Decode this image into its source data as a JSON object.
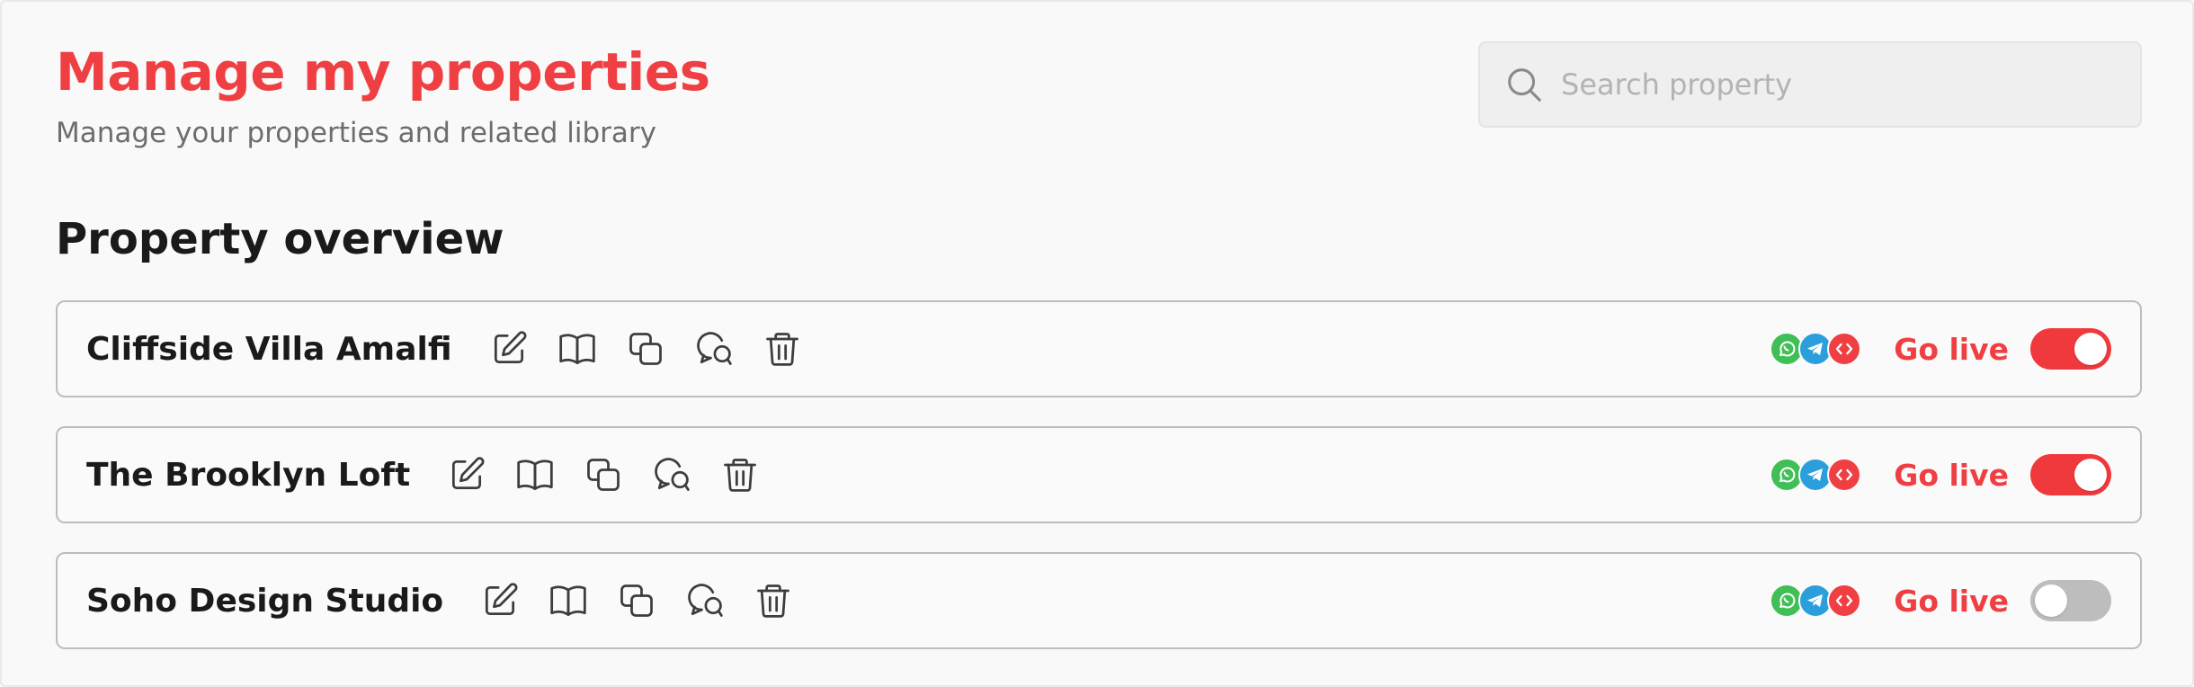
{
  "header": {
    "title": "Manage my properties",
    "subtitle": "Manage your properties and related library"
  },
  "search": {
    "placeholder": "Search property",
    "value": "",
    "icon": "search-icon"
  },
  "overview": {
    "title": "Property overview",
    "go_live_label": "Go live",
    "channel_icons": [
      "whatsapp-icon",
      "telegram-icon",
      "embed-code-icon"
    ],
    "action_icons": [
      "edit-icon",
      "library-book-icon",
      "duplicate-icon",
      "chat-icon",
      "delete-icon"
    ],
    "properties": [
      {
        "name": "Cliffside Villa Amalfi",
        "live": true
      },
      {
        "name": "The Brooklyn Loft",
        "live": true
      },
      {
        "name": "Soho Design Studio",
        "live": false
      }
    ]
  },
  "colors": {
    "accent": "#ef3f43",
    "whatsapp": "#3fbf55",
    "telegram": "#2b9fdc",
    "toggle_off": "#bdbdbd"
  }
}
